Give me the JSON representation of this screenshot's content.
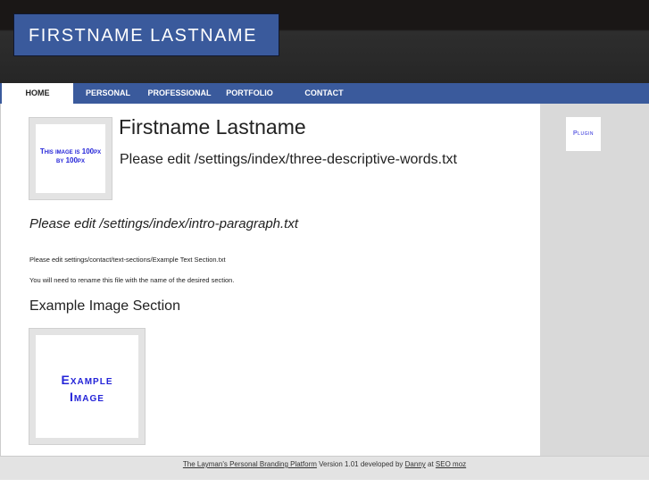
{
  "header": {
    "logo": "FIRSTNAME LASTNAME"
  },
  "nav": [
    {
      "label": "HOME",
      "active": true
    },
    {
      "label": "PERSONAL"
    },
    {
      "label": "PROFESSIONAL"
    },
    {
      "label": "PORTFOLIO"
    },
    {
      "label": "CONTACT"
    }
  ],
  "main": {
    "profile_image_text": "This image is 100px by 100px",
    "name": "Firstname Lastname",
    "descriptive_words": "Please edit /settings/index/three-descriptive-words.txt",
    "intro": "Please edit /settings/index/intro-paragraph.txt",
    "text_section_line1": "Please edit settings/contact/text-sections/Example Text Section.txt",
    "text_section_line2": "You will need to rename this file with the name of the desired section.",
    "image_section_title": "Example Image Section",
    "example_image_text": "Example Image"
  },
  "sidebar": {
    "plugin": "Plugin"
  },
  "footer": {
    "platform_link": "The Layman's Personal Branding Platform",
    "version_text": " Version 1.01 developed by ",
    "author_link": "Danny",
    "at_text": " at ",
    "company_link": "SEO moz"
  }
}
